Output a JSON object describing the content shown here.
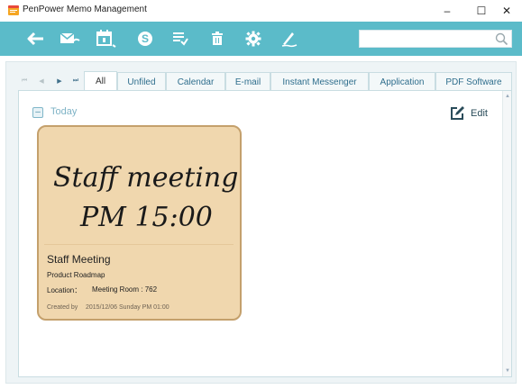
{
  "window": {
    "title": "PenPower Memo Management",
    "controls": {
      "minimize": "–",
      "maximize": "☐",
      "close": "✕"
    }
  },
  "toolbar": {
    "icons": [
      "back-arrow-icon",
      "mail-icon",
      "calendar-icon",
      "skype-icon",
      "checklist-icon",
      "trash-icon",
      "gear-icon",
      "pen-icon"
    ],
    "search": {
      "value": "",
      "placeholder": ""
    },
    "accent_color": "#5bbbc9"
  },
  "nav_arrows": [
    "⏮",
    "◀",
    "▶",
    "⏭"
  ],
  "tabs": [
    {
      "label": "All",
      "active": true
    },
    {
      "label": "Unfiled",
      "active": false
    },
    {
      "label": "Calendar",
      "active": false
    },
    {
      "label": "E-mail",
      "active": false
    },
    {
      "label": "Instant Messenger",
      "active": false
    },
    {
      "label": "Application",
      "active": false
    },
    {
      "label": "PDF Software",
      "active": false
    }
  ],
  "group": {
    "toggle": "–",
    "label": "Today"
  },
  "edit": {
    "label": "Edit"
  },
  "memo": {
    "handwriting_line1": "Staff meeting",
    "handwriting_line2": "PM 15:00",
    "title": "Staff Meeting",
    "subtitle": "Product Roadmap",
    "location_label": "Location：",
    "location_value": "Meeting Room : 762",
    "created_label": "Created by",
    "created_value": "2015/12/06 Sunday PM 01:00",
    "card_color": "#f0d7ae",
    "border_color": "#c4a06c"
  }
}
